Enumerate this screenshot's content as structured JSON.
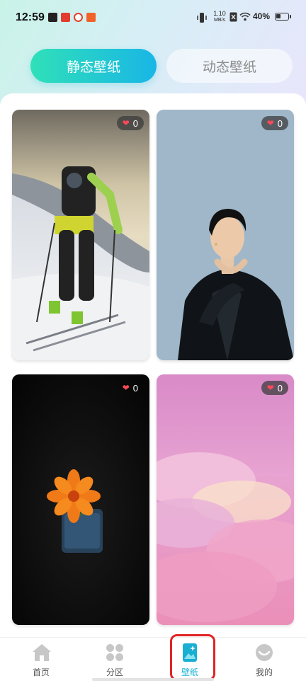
{
  "status_bar": {
    "time": "12:59",
    "net_speed_value": "1.10",
    "net_speed_unit": "MB/s",
    "battery_text": "40%",
    "battery_level": 0.4
  },
  "tabs": [
    {
      "label": "静态壁纸",
      "active": true
    },
    {
      "label": "动态壁纸",
      "active": false
    }
  ],
  "wallpapers": [
    {
      "likes": "0",
      "subject": "skier-on-snowy-mountain"
    },
    {
      "likes": "0",
      "subject": "woman-in-black-suit"
    },
    {
      "likes": "0",
      "subject": "orange-flower-in-vase"
    },
    {
      "likes": "0",
      "subject": "pink-clouds"
    }
  ],
  "bottom_nav": [
    {
      "label": "首页",
      "icon": "home-icon",
      "active": false
    },
    {
      "label": "分区",
      "icon": "category-grid-icon",
      "active": false
    },
    {
      "label": "壁纸",
      "icon": "wallpaper-icon",
      "active": true
    },
    {
      "label": "我的",
      "icon": "profile-icon",
      "active": false
    }
  ],
  "colors": {
    "accent": "#19b3d6",
    "tab_gradient_start": "#2fe0b8",
    "tab_gradient_end": "#19b6e6",
    "like_heart": "#ff4a5a",
    "highlight_box": "#e02424"
  }
}
